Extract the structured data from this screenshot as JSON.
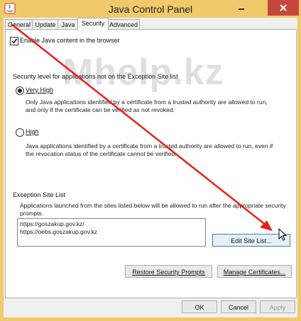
{
  "window": {
    "title": "Java Control Panel",
    "app_icon": "java-icon",
    "accent": "#f0c96b"
  },
  "tabs": [
    {
      "label": "General",
      "active": false
    },
    {
      "label": "Update",
      "active": false
    },
    {
      "label": "Java",
      "active": false
    },
    {
      "label": "Security",
      "active": true
    },
    {
      "label": "Advanced",
      "active": false
    }
  ],
  "security": {
    "enable_java_checkbox": {
      "label": "Enable Java content in the browser",
      "checked": true
    },
    "level_heading": "Security level for applications not on the Exception Site list",
    "options": [
      {
        "label": "Very High",
        "selected": true,
        "desc1": "Only Java applications identified by a certificate from a trusted authority are allowed to run,",
        "desc2": "and only if the certificate can be verified as not revoked."
      },
      {
        "label": "High",
        "selected": false,
        "desc1": "Java applications identified by a certificate from a trusted authority are allowed to run, even if",
        "desc2": "the revocation status of the certificate cannot be verified."
      }
    ]
  },
  "exception_site_list": {
    "heading": "Exception Site List",
    "desc1": "Applications launched from the sites listed below will be allowed to run after the appropriate security",
    "desc2": "prompts.",
    "sites": [
      "https://goszakup.gov.kz/",
      "https://oebs.goszakup.gov.kz"
    ],
    "edit_button": "Edit Site List..."
  },
  "buttons": {
    "restore_prompts": "Restore Security Prompts",
    "manage_certs": "Manage Certificates..."
  },
  "dialog_buttons": {
    "ok": "OK",
    "cancel": "Cancel",
    "apply": "Apply"
  },
  "watermark": "Mhelp.kz",
  "annotation": {
    "color": "#e8221b"
  }
}
